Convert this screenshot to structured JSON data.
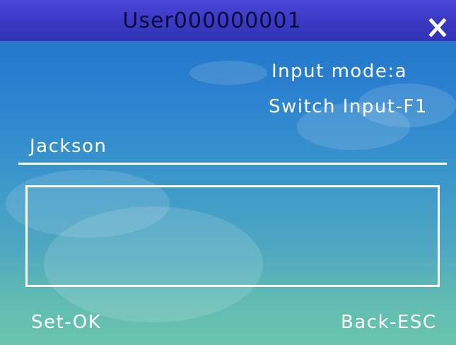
{
  "window": {
    "title": "User000000001",
    "close_icon": "close-icon"
  },
  "status": {
    "input_mode": "Input mode:a",
    "switch_hint": "Switch Input-F1"
  },
  "field": {
    "value": "Jackson"
  },
  "entry_box": {
    "value": ""
  },
  "softkeys": {
    "left": "Set-OK",
    "right": "Back-ESC"
  }
}
